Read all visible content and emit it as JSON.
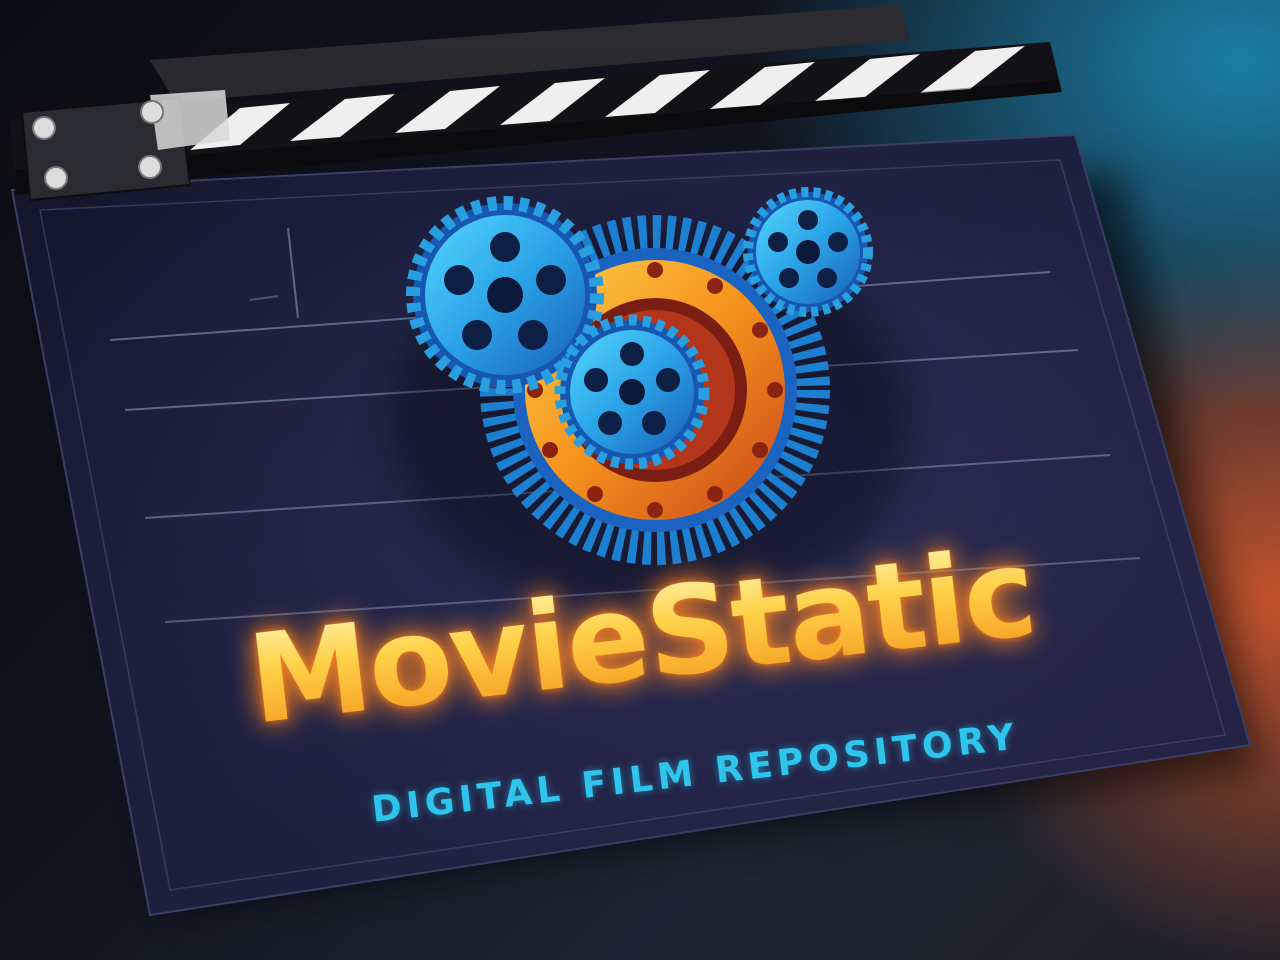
{
  "logo": {
    "title": "MovieStatic",
    "tagline": "DIGITAL FILM REPOSITORY"
  },
  "icons": {
    "clapperboard": "clapperboard-icon",
    "gear_left": "gear-icon",
    "gear_right": "gear-icon",
    "gear_center": "gear-icon",
    "film_reel": "film-reel-icon"
  },
  "colors": {
    "board": "#1a1d38",
    "title_glow": "#ffb62e",
    "tagline": "#2fc4ec",
    "gear": "#2a9fe0",
    "reel": "#f08a1c"
  }
}
